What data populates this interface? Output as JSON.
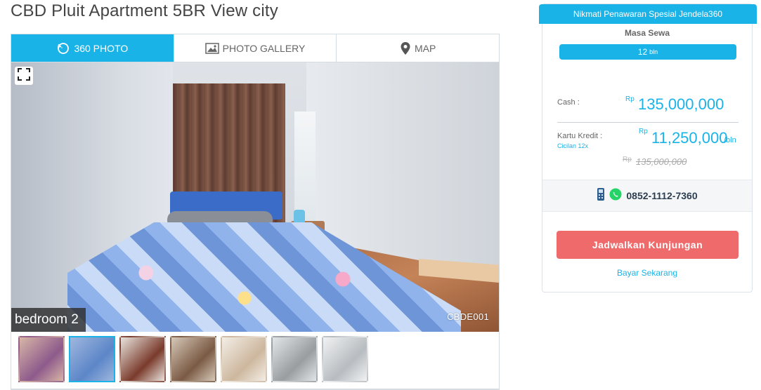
{
  "listing": {
    "title": "CBD Pluit Apartment 5BR View city"
  },
  "tabs": [
    {
      "label": "360 PHOTO",
      "icon": "rotate-360-icon",
      "active": true
    },
    {
      "label": "PHOTO GALLERY",
      "icon": "image-icon",
      "active": false
    },
    {
      "label": "MAP",
      "icon": "map-pin-icon",
      "active": false
    }
  ],
  "viewer": {
    "room_label": "bedroom 2",
    "code": "CBDE001"
  },
  "thumbnails": [
    {
      "name": "bedroom-1",
      "selected": false,
      "colors": [
        "#8e5a8c",
        "#d7b6a6"
      ]
    },
    {
      "name": "bedroom-2",
      "selected": true,
      "colors": [
        "#5c86c8",
        "#9fb7de"
      ]
    },
    {
      "name": "living-room",
      "selected": false,
      "colors": [
        "#7a3b2c",
        "#e9e4de"
      ]
    },
    {
      "name": "kitchen",
      "selected": false,
      "colors": [
        "#7a5a44",
        "#d6c8b8"
      ]
    },
    {
      "name": "bathroom-sink",
      "selected": false,
      "colors": [
        "#cdb79e",
        "#f3eee6"
      ]
    },
    {
      "name": "shower",
      "selected": false,
      "colors": [
        "#9a9d9f",
        "#e3e6e8"
      ]
    },
    {
      "name": "bathroom",
      "selected": false,
      "colors": [
        "#b7bcc0",
        "#f1f2f3"
      ]
    }
  ],
  "offer": {
    "banner": "Nikmati Penawaran Spesial Jendela360"
  },
  "rental": {
    "label": "Masa Sewa",
    "duration_value": "12",
    "duration_unit": "bln"
  },
  "pricing": {
    "currency": "Rp",
    "cash_label": "Cash :",
    "cash_price": "135,000,000",
    "credit_label": "Kartu Kredit :",
    "credit_note": "Cicilan 12x",
    "credit_price": "11,250,000",
    "credit_unit": "/bln",
    "original_price": "135,000,000"
  },
  "contact": {
    "phone": "0852-1112-7360"
  },
  "actions": {
    "schedule": "Jadwalkan Kunjungan",
    "pay_now": "Bayar Sekarang"
  },
  "colors": {
    "accent": "#1ab3e8",
    "cta": "#ef6a6a",
    "whatsapp": "#25d366"
  }
}
